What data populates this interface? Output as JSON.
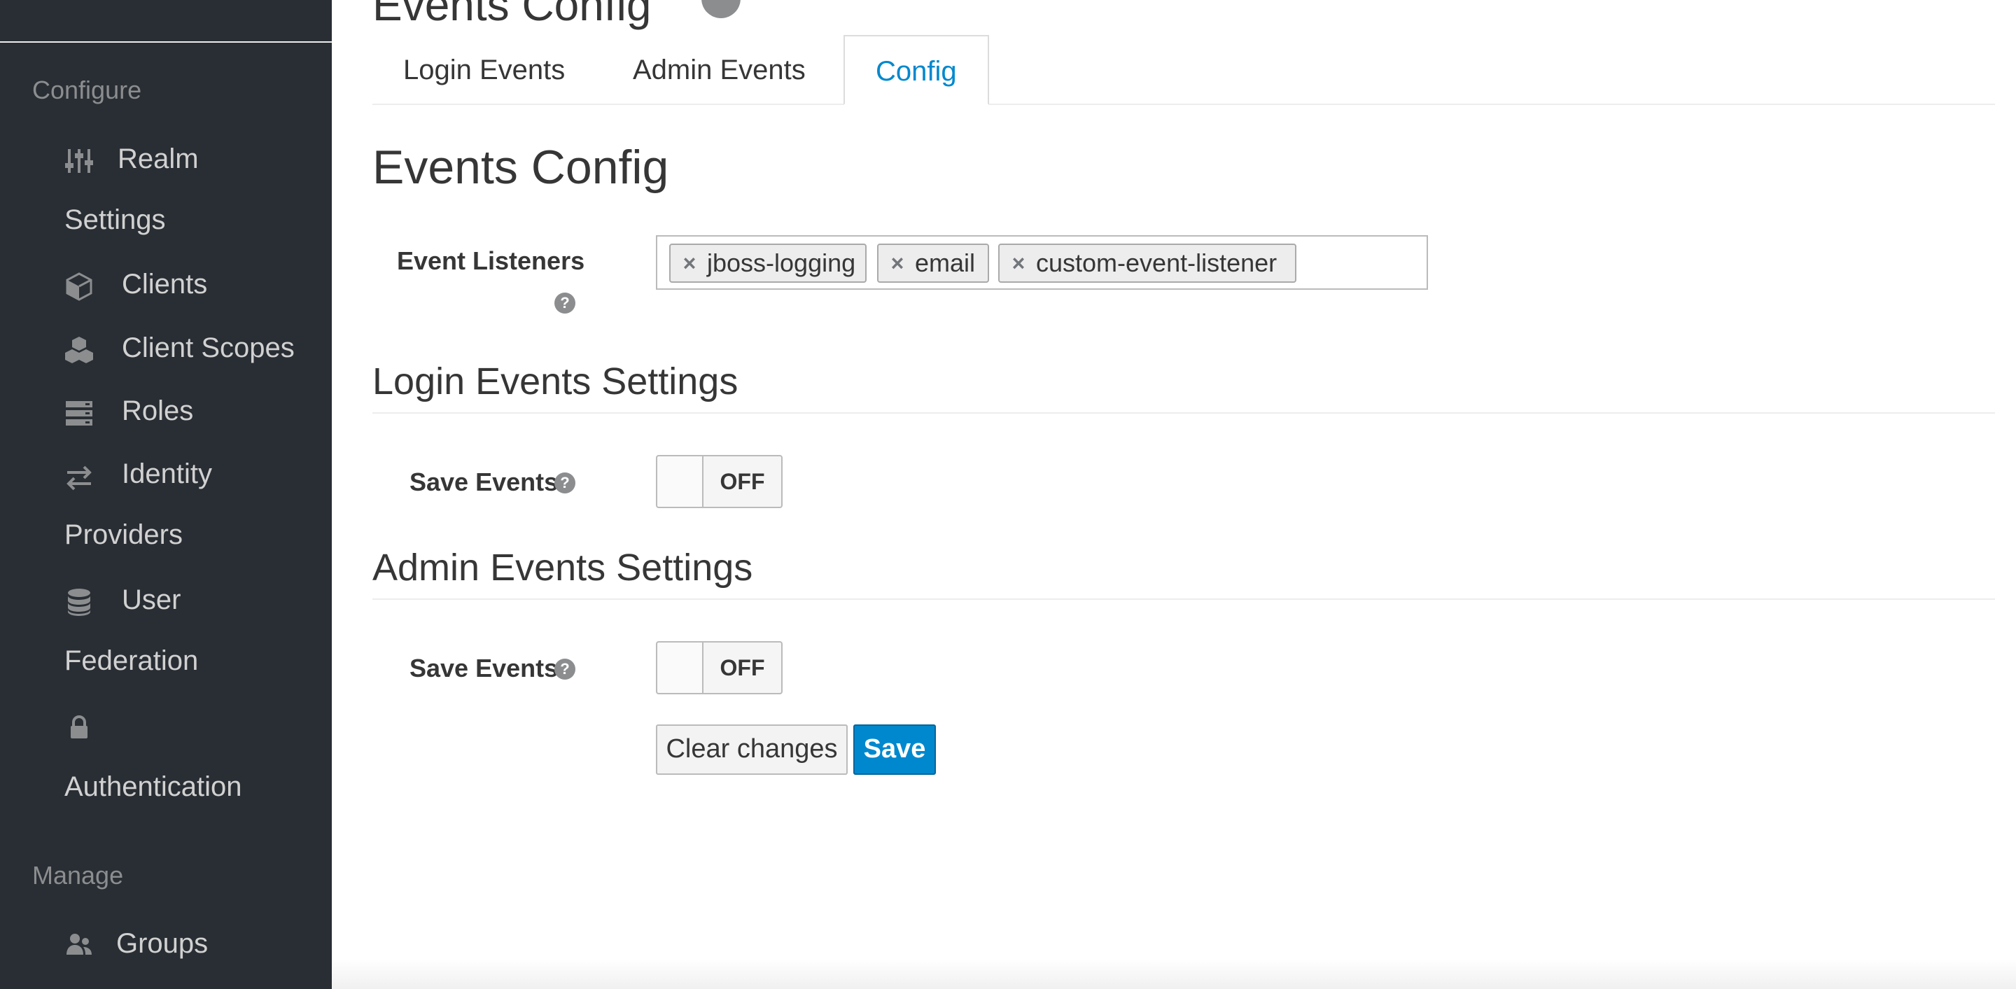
{
  "sidebar": {
    "configure_heading": "Configure",
    "manage_heading": "Manage",
    "items": [
      {
        "line1": "Realm",
        "line2": "Settings",
        "icon": "sliders-icon"
      },
      {
        "line1": "Clients",
        "line2": "",
        "icon": "cube-icon"
      },
      {
        "line1": "Client Scopes",
        "line2": "",
        "icon": "cubes-icon"
      },
      {
        "line1": "Roles",
        "line2": "",
        "icon": "list-icon"
      },
      {
        "line1": "Identity",
        "line2": "Providers",
        "icon": "exchange-icon"
      },
      {
        "line1": "User",
        "line2": "Federation",
        "icon": "database-icon"
      },
      {
        "line1": "",
        "line2": "Authentication",
        "icon": "lock-icon"
      },
      {
        "line1": "Groups",
        "line2": "",
        "icon": "users-icon"
      }
    ]
  },
  "header": {
    "title_partial": "Events Config"
  },
  "tabs": [
    {
      "label": "Login Events",
      "active": false
    },
    {
      "label": "Admin Events",
      "active": false
    },
    {
      "label": "Config",
      "active": true
    }
  ],
  "main": {
    "title": "Events Config",
    "event_listeners_label": "Event Listeners",
    "event_listeners": [
      "jboss-logging",
      "email",
      "custom-event-listener"
    ],
    "login_settings": {
      "title": "Login Events Settings",
      "save_events_label": "Save Events",
      "save_events_state": "OFF"
    },
    "admin_settings": {
      "title": "Admin Events Settings",
      "save_events_label": "Save Events",
      "save_events_state": "OFF"
    },
    "buttons": {
      "clear": "Clear changes",
      "save": "Save"
    }
  },
  "colors": {
    "sidebar_bg": "#292e34",
    "accent": "#0088ce"
  }
}
